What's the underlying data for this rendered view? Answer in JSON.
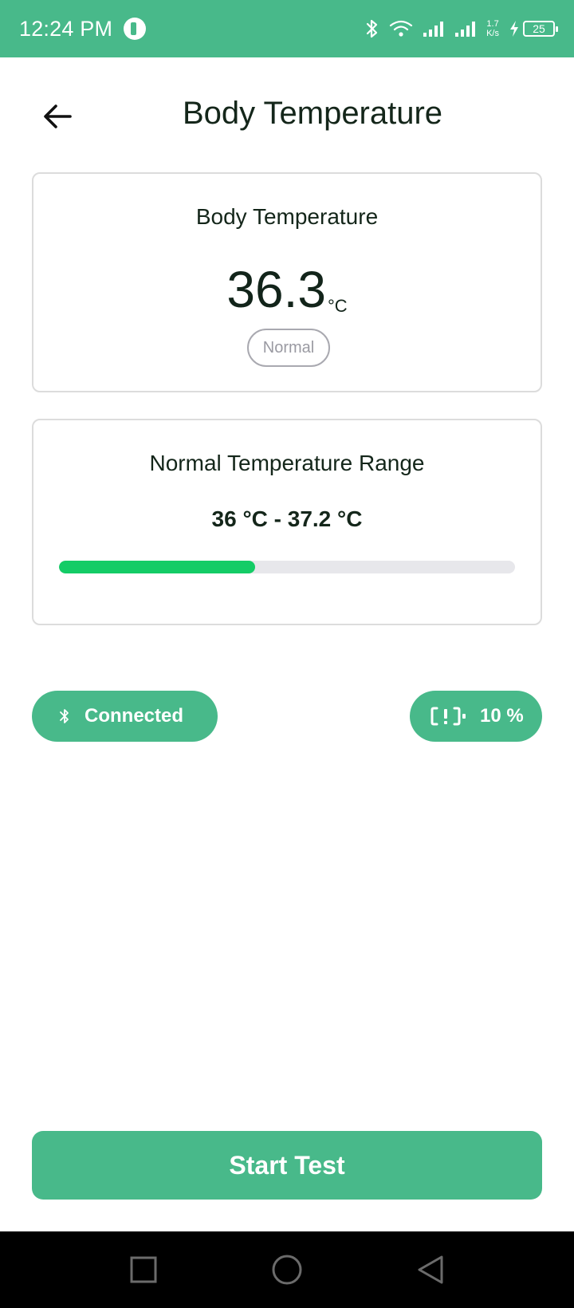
{
  "colors": {
    "accent": "#48b98a",
    "progress": "#14cc66",
    "status_pill": "#a9a9b0"
  },
  "status_bar": {
    "time": "12:24 PM",
    "net_speed_value": "1.7",
    "net_speed_unit": "K/s",
    "battery_level": "25",
    "icons": [
      "app-notification-icon",
      "bluetooth-icon",
      "wifi-icon",
      "signal-icon",
      "signal-icon",
      "charging-icon",
      "battery-icon"
    ]
  },
  "header": {
    "title": "Body Temperature",
    "back_icon": "arrow-left-icon"
  },
  "temperature_card": {
    "label": "Body Temperature",
    "value": "36.3",
    "unit": "°C",
    "status": "Normal"
  },
  "range_card": {
    "label": "Normal Temperature Range",
    "range_text": "36 °C - 37.2 °C",
    "progress_fraction": 0.43
  },
  "chips": {
    "connection_label": "Connected",
    "connection_icon": "bluetooth-icon",
    "battery_label": "10 %",
    "battery_icon": "battery-alert-icon"
  },
  "actions": {
    "start_test_label": "Start Test"
  },
  "nav_bar": {
    "icons": [
      "recents-square-icon",
      "home-circle-icon",
      "back-triangle-icon"
    ]
  }
}
